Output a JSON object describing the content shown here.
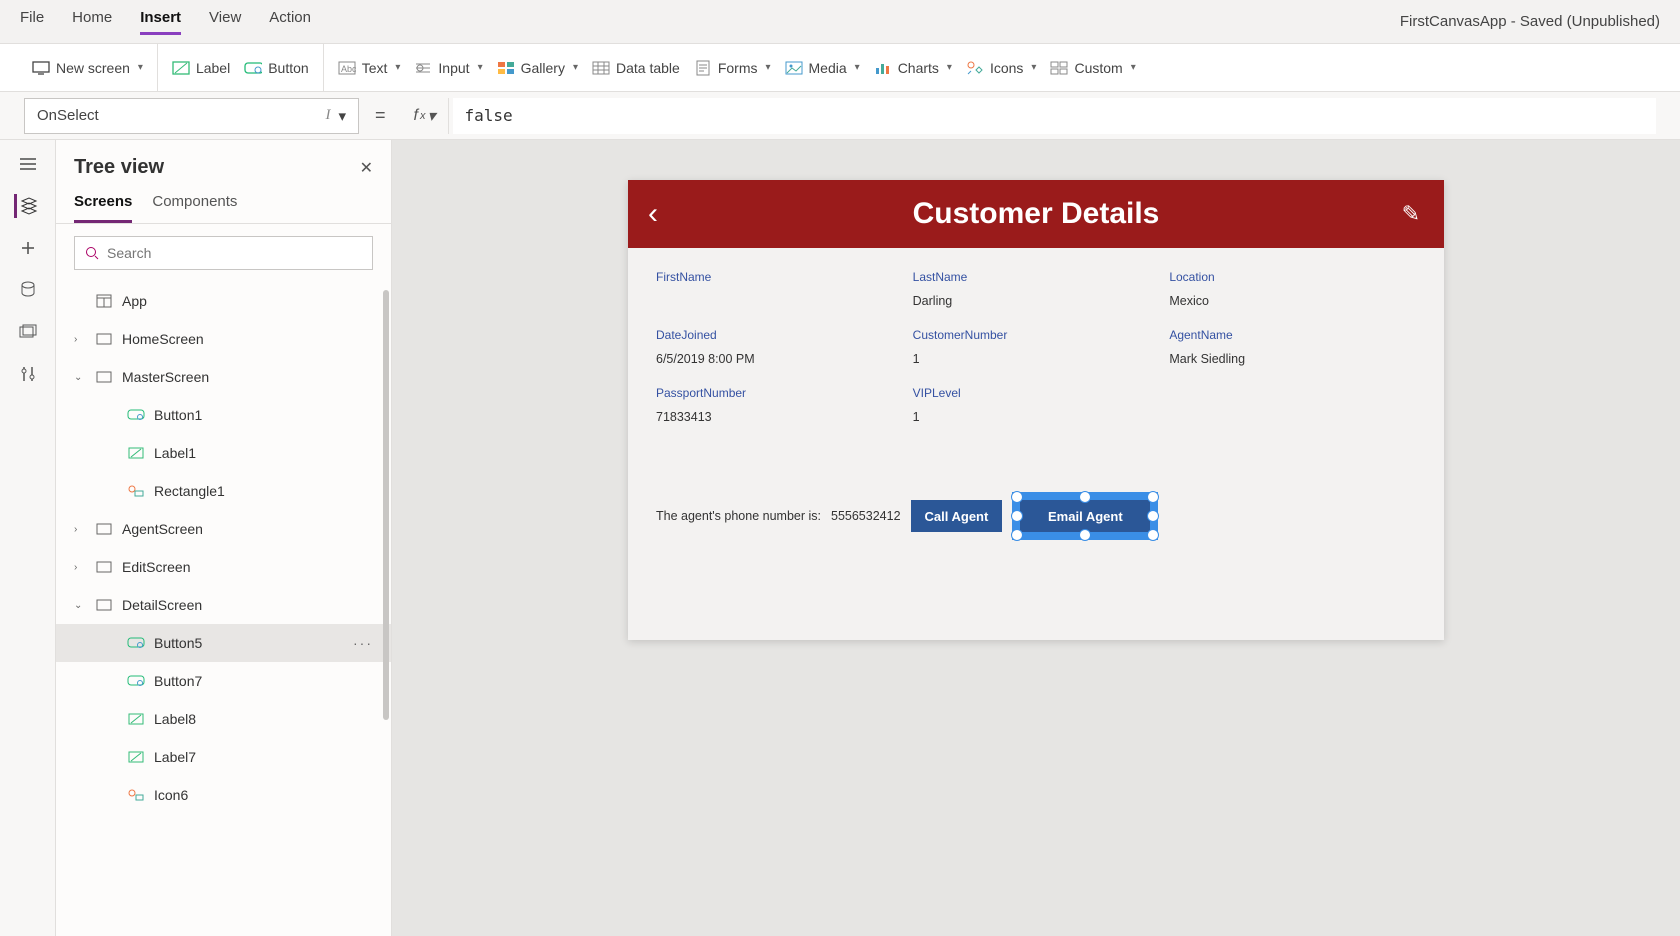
{
  "app_title": "FirstCanvasApp - Saved (Unpublished)",
  "menubar": [
    "File",
    "Home",
    "Insert",
    "View",
    "Action"
  ],
  "menubar_active": "Insert",
  "ribbon": {
    "newscreen": "New screen",
    "label": "Label",
    "button": "Button",
    "text": "Text",
    "input": "Input",
    "gallery": "Gallery",
    "datatable": "Data table",
    "forms": "Forms",
    "media": "Media",
    "charts": "Charts",
    "icons": "Icons",
    "custom": "Custom"
  },
  "formula": {
    "property": "OnSelect",
    "expr": "false"
  },
  "tree": {
    "title": "Tree view",
    "tabs": [
      "Screens",
      "Components"
    ],
    "active_tab": "Screens",
    "search_placeholder": "Search",
    "nodes": {
      "app": "App",
      "home": "HomeScreen",
      "master": "MasterScreen",
      "button1": "Button1",
      "label1": "Label1",
      "rect1": "Rectangle1",
      "agent": "AgentScreen",
      "edit": "EditScreen",
      "detail": "DetailScreen",
      "button5": "Button5",
      "button7": "Button7",
      "label8": "Label8",
      "label7": "Label7",
      "icon6": "Icon6"
    }
  },
  "phone": {
    "title": "Customer Details",
    "labels": {
      "firstname": "FirstName",
      "lastname": "LastName",
      "location": "Location",
      "datejoined": "DateJoined",
      "custnum": "CustomerNumber",
      "agentname": "AgentName",
      "passport": "PassportNumber",
      "vip": "VIPLevel"
    },
    "values": {
      "firstname": "",
      "lastname": "Darling",
      "location": "Mexico",
      "datejoined": "6/5/2019 8:00 PM",
      "custnum": "1",
      "agentname": "Mark Siedling",
      "passport": "71833413",
      "vip": "1"
    },
    "agent_text": "The agent's phone number is:",
    "agent_phone": "5556532412",
    "call_btn": "Call Agent",
    "email_btn": "Email Agent"
  }
}
